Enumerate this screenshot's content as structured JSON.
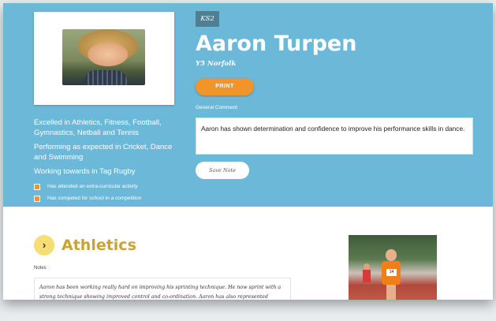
{
  "student": {
    "key_stage": "KS2",
    "name": "Aaron Turpen",
    "class": "Y5 Norfolk",
    "photo_alt": "Student photo"
  },
  "achievements": {
    "excelled": "Excelled in Athletics, Fitness, Football, Gymnastics, Netball and Tennis",
    "expected": "Performing as expected in Cricket, Dance and Swimming",
    "working_towards": "Working towards in Tag Rugby",
    "checks": [
      {
        "label": "Has attended an extra-curricular activity",
        "checked": true
      },
      {
        "label": "Has competed for school in a competition",
        "checked": true
      }
    ]
  },
  "actions": {
    "print_label": "PRINT",
    "save_label": "Save Note"
  },
  "comment": {
    "label": "General Comment",
    "value": "Aaron has shown determination and confidence to improve his performance skills in dance."
  },
  "section": {
    "icon": "chevron-right-icon",
    "title": "Athletics",
    "notes_label": "Notes",
    "notes_line1": "Aaron has been working really hard on improving his sprinting technique. He now sprint with a",
    "notes_line2": "strong technique showing improved control and co-ordination. Aaron has also represented school in",
    "photo_number": "14"
  },
  "colors": {
    "hero_bg": "#6cb8d8",
    "accent_orange": "#f0952a",
    "section_title": "#c9a433",
    "icon_circle": "#f6dd74"
  }
}
